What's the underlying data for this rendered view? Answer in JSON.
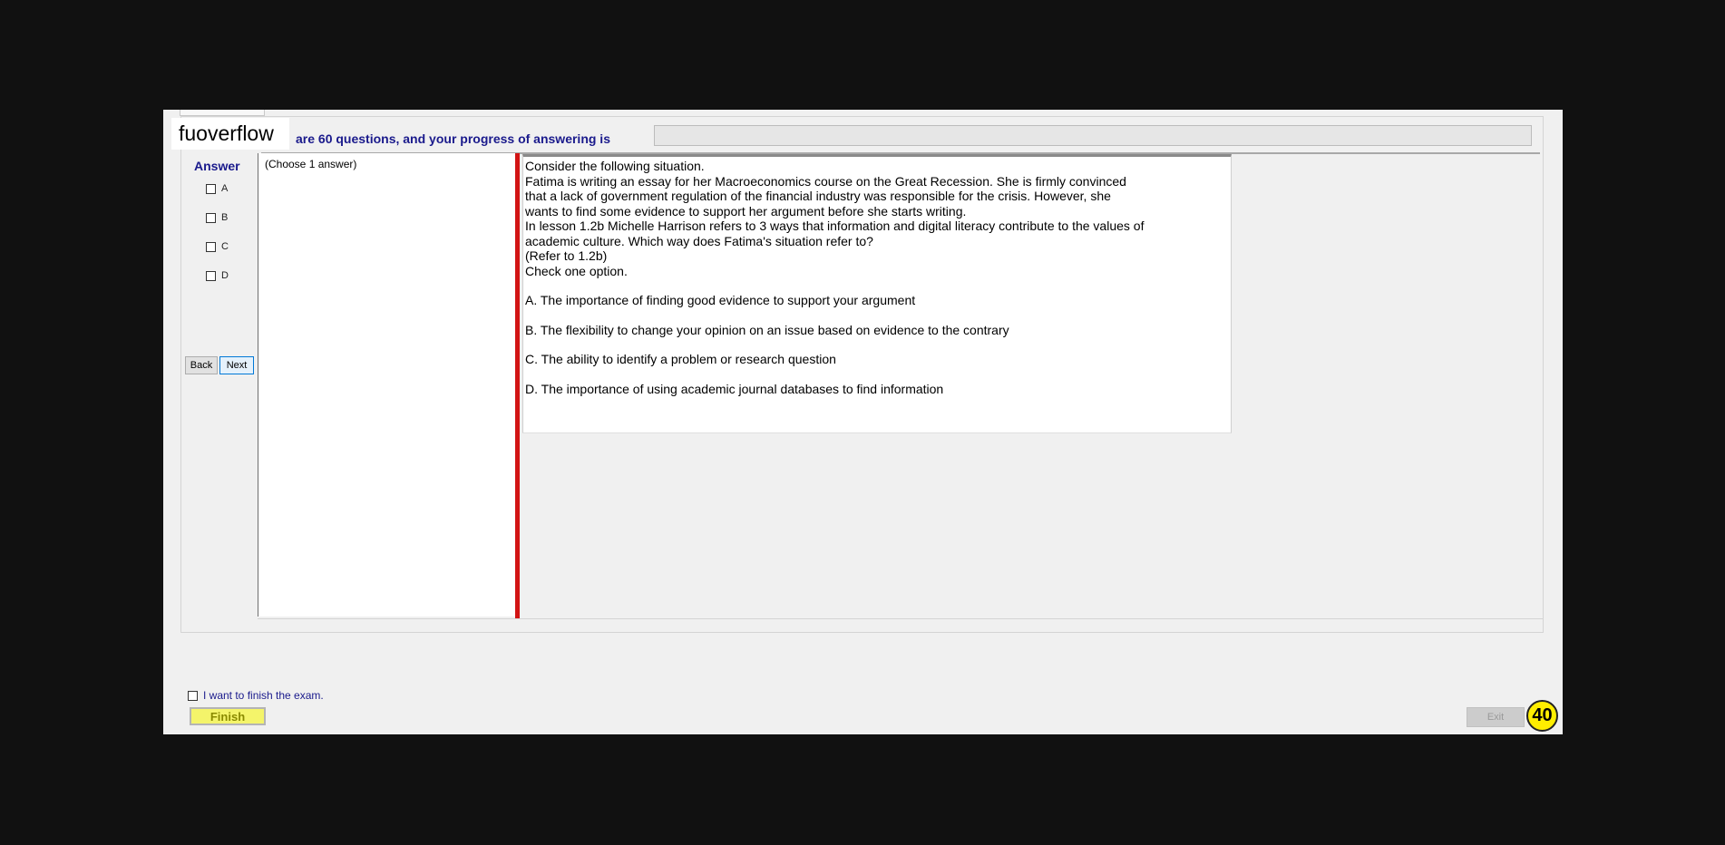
{
  "brand": {
    "logo_text": "fuoverflow"
  },
  "header": {
    "progress_text": "are 60 questions, and your progress of answering is",
    "progress_fraction": 0
  },
  "answer_panel": {
    "title": "Answer",
    "options": [
      "A",
      "B",
      "C",
      "D"
    ],
    "back_label": "Back",
    "next_label": "Next"
  },
  "choose_text": "(Choose 1 answer)",
  "question": {
    "lines": [
      "Consider the following situation.",
      "Fatima is writing an essay for her Macroeconomics course on the Great Recession. She is firmly convinced",
      "that a lack of government regulation of the financial industry was responsible for the crisis. However, she",
      "wants to find some evidence to support her argument before she starts writing.",
      "In lesson 1.2b Michelle Harrison refers to 3 ways that information and digital literacy contribute to the values of",
      "academic culture. Which way does Fatima's situation refer to?",
      "(Refer to 1.2b)",
      "Check one option."
    ],
    "options": [
      "A.  The importance of finding good evidence to support your argument",
      "B.  The flexibility to change your opinion on an issue based on evidence to the contrary",
      "C.  The ability to identify a problem or research question",
      "D.  The importance of using academic journal databases to find information"
    ]
  },
  "footer": {
    "finish_checkbox_label": "I want to finish the exam.",
    "finish_label": "Finish",
    "exit_label": "Exit",
    "badge_number": "40"
  },
  "colors": {
    "accent": "#1a1a8c",
    "red_divider": "#d21414",
    "finish_bg": "#f4f46a",
    "badge_bg": "#ffee00"
  }
}
